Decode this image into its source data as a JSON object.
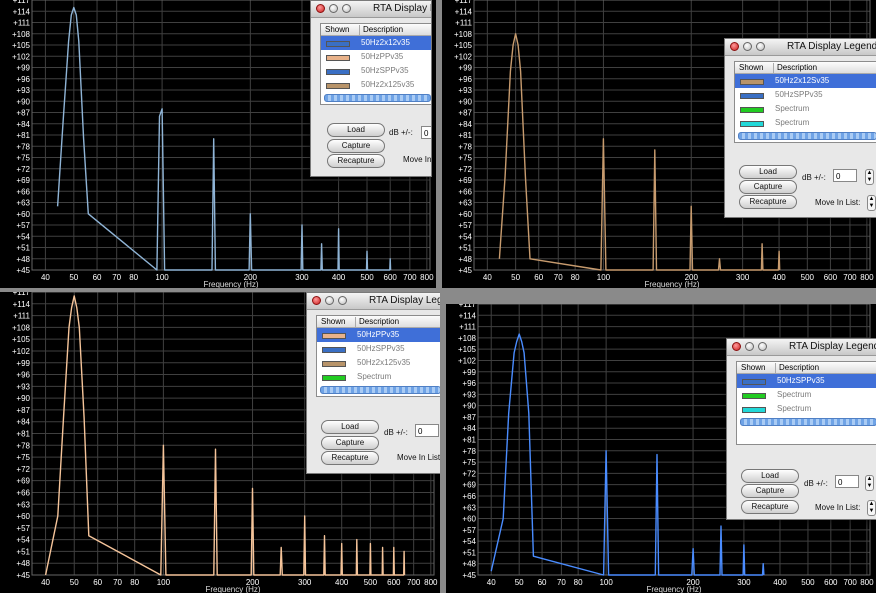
{
  "xlabel": "Frequency (Hz)",
  "y_ticks": [
    "+117",
    "+114",
    "+111",
    "+108",
    "+105",
    "+102",
    "+99",
    "+96",
    "+93",
    "+90",
    "+87",
    "+84",
    "+81",
    "+78",
    "+75",
    "+72",
    "+69",
    "+66",
    "+63",
    "+60",
    "+57",
    "+54",
    "+51",
    "+48",
    "+45"
  ],
  "x_ticks": [
    "40",
    "50",
    "60",
    "70",
    "80",
    "100",
    "200",
    "300",
    "400",
    "500",
    "600",
    "700",
    "800"
  ],
  "legend": {
    "title": "RTA Display Legend",
    "col_shown": "Shown",
    "col_description": "Description",
    "load_label": "Load",
    "capture_label": "Capture",
    "recapture_label": "Recapture",
    "db_label": "dB +/-:",
    "db_value": "0",
    "move_label": "Move In List:"
  },
  "colors": {
    "grid": "#404040",
    "background": "#000000",
    "selection": "#3f6fd8"
  },
  "chart_data": [
    {
      "type": "line",
      "xlabel": "Frequency (Hz)",
      "xscale": "log",
      "xlim": [
        36,
        820
      ],
      "ylim": [
        45,
        117
      ],
      "color": "#8fb4d6",
      "series": [
        {
          "name": "50Hz2x12v35",
          "x": [
            44,
            46,
            48,
            49,
            50,
            51,
            52,
            54,
            56,
            96,
            98,
            100,
            102,
            148,
            150,
            152,
            198,
            200,
            202,
            298,
            300,
            302,
            348,
            350,
            352,
            398,
            400,
            402,
            498,
            500,
            502,
            598,
            600,
            602
          ],
          "y": [
            62,
            85,
            106,
            113,
            115,
            113,
            106,
            80,
            60,
            45,
            86,
            88,
            45,
            45,
            80,
            45,
            45,
            60,
            45,
            45,
            57,
            45,
            45,
            52,
            45,
            45,
            56,
            45,
            45,
            50,
            45,
            45,
            48,
            45
          ]
        }
      ],
      "legend_items": [
        {
          "label": "50Hz2x12v35",
          "color": "#3a6fc4",
          "selected": true
        },
        {
          "label": "50HzPPv35",
          "color": "#e8b28a",
          "selected": false
        },
        {
          "label": "50HzSPPv35",
          "color": "#3a6fc4",
          "selected": false
        },
        {
          "label": "50Hz2x125v35",
          "color": "#b8946a",
          "selected": false
        }
      ]
    },
    {
      "type": "line",
      "xlabel": "Frequency (Hz)",
      "xscale": "log",
      "xlim": [
        36,
        820
      ],
      "ylim": [
        45,
        117
      ],
      "color": "#c79b6e",
      "series": [
        {
          "name": "50Hz2x12Sv35",
          "x": [
            44,
            46,
            48,
            49,
            50,
            51,
            52,
            54,
            56,
            98,
            100,
            102,
            148,
            150,
            152,
            198,
            200,
            202,
            248,
            250,
            252,
            348,
            350,
            352,
            398,
            400,
            402
          ],
          "y": [
            48,
            70,
            98,
            105,
            108,
            105,
            98,
            70,
            48,
            45,
            80,
            45,
            45,
            77,
            45,
            45,
            62,
            45,
            45,
            48,
            45,
            45,
            52,
            45,
            45,
            50,
            45
          ]
        }
      ],
      "legend_items": [
        {
          "label": "50Hz2x12Sv35",
          "color": "#b8946a",
          "selected": true
        },
        {
          "label": "50HzSPPv35",
          "color": "#3a6fc4",
          "selected": false
        },
        {
          "label": "Spectrum",
          "color": "#22cc22",
          "selected": false
        },
        {
          "label": "Spectrum",
          "color": "#22d8d8",
          "selected": false
        }
      ]
    },
    {
      "type": "line",
      "xlabel": "Frequency (Hz)",
      "xscale": "log",
      "xlim": [
        36,
        820
      ],
      "ylim": [
        45,
        117
      ],
      "color": "#f5c49a",
      "series": [
        {
          "name": "50HzPPv35",
          "x": [
            40,
            44,
            46,
            48,
            49,
            50,
            51,
            52,
            54,
            56,
            98,
            100,
            102,
            148,
            150,
            152,
            198,
            200,
            202,
            248,
            250,
            252,
            298,
            300,
            302,
            348,
            350,
            352,
            398,
            400,
            402,
            448,
            450,
            452,
            498,
            500,
            502,
            548,
            550,
            552,
            598,
            600,
            602,
            648,
            650,
            652
          ],
          "y": [
            45,
            60,
            85,
            108,
            113,
            116,
            113,
            108,
            85,
            55,
            45,
            78,
            45,
            45,
            77,
            45,
            45,
            67,
            45,
            45,
            52,
            45,
            45,
            60,
            45,
            45,
            55,
            45,
            45,
            53,
            45,
            45,
            54,
            45,
            45,
            53,
            45,
            45,
            52,
            45,
            45,
            52,
            45,
            45,
            51,
            45
          ]
        }
      ],
      "legend_items": [
        {
          "label": "50HzPPv35",
          "color": "#e8b28a",
          "selected": true
        },
        {
          "label": "50HzSPPv35",
          "color": "#3a6fc4",
          "selected": false
        },
        {
          "label": "50Hz2x125v35",
          "color": "#b8946a",
          "selected": false
        },
        {
          "label": "Spectrum",
          "color": "#22cc22",
          "selected": false
        }
      ]
    },
    {
      "type": "line",
      "xlabel": "Frequency (Hz)",
      "xscale": "log",
      "xlim": [
        36,
        820
      ],
      "ylim": [
        45,
        117
      ],
      "color": "#4a8cff",
      "series": [
        {
          "name": "50HzSPPv35",
          "x": [
            40,
            44,
            46,
            48,
            49,
            50,
            51,
            52,
            54,
            56,
            98,
            100,
            102,
            148,
            150,
            152,
            198,
            200,
            202,
            248,
            250,
            252,
            298,
            300,
            302,
            348,
            350,
            352
          ],
          "y": [
            46,
            60,
            88,
            104,
            107,
            109,
            107,
            104,
            88,
            50,
            45,
            78,
            45,
            45,
            77,
            45,
            45,
            52,
            45,
            45,
            58,
            45,
            45,
            53,
            45,
            45,
            48,
            45
          ]
        }
      ],
      "legend_items": [
        {
          "label": "50HzSPPv35",
          "color": "#3a6fc4",
          "selected": true
        },
        {
          "label": "Spectrum",
          "color": "#22cc22",
          "selected": false
        },
        {
          "label": "Spectrum",
          "color": "#22d8d8",
          "selected": false
        }
      ]
    }
  ]
}
